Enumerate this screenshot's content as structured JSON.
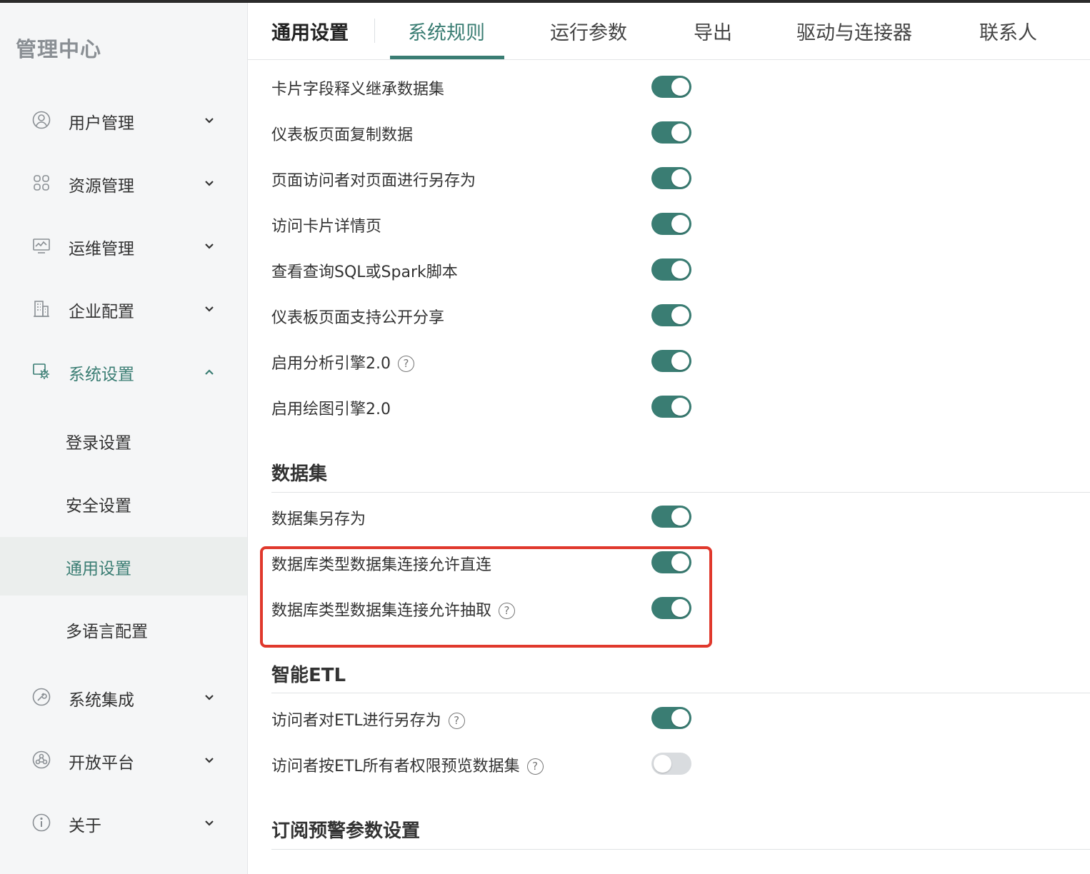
{
  "sidebar": {
    "brand": "管理中心",
    "items": [
      {
        "label": "用户管理",
        "icon": "user-circle-icon"
      },
      {
        "label": "资源管理",
        "icon": "grid-icon"
      },
      {
        "label": "运维管理",
        "icon": "monitor-icon"
      },
      {
        "label": "企业配置",
        "icon": "building-icon"
      },
      {
        "label": "系统设置",
        "icon": "settings-icon"
      },
      {
        "label": "系统集成",
        "icon": "wrench-icon"
      },
      {
        "label": "开放平台",
        "icon": "network-icon"
      },
      {
        "label": "关于",
        "icon": "info-icon"
      }
    ],
    "subitems": [
      {
        "label": "登录设置"
      },
      {
        "label": "安全设置"
      },
      {
        "label": "通用设置"
      },
      {
        "label": "多语言配置"
      }
    ]
  },
  "tabs": [
    {
      "label": "通用设置"
    },
    {
      "label": "系统规则"
    },
    {
      "label": "运行参数"
    },
    {
      "label": "导出"
    },
    {
      "label": "驱动与连接器"
    },
    {
      "label": "联系人"
    }
  ],
  "colors": {
    "accent": "#3a7d73",
    "highlight": "#e0382c",
    "toggle_off": "#d9dcdf"
  },
  "settings_top": [
    {
      "label": "卡片字段释义继承数据集",
      "on": true
    },
    {
      "label": "仪表板页面复制数据",
      "on": true
    },
    {
      "label": "页面访问者对页面进行另存为",
      "on": true
    },
    {
      "label": "访问卡片详情页",
      "on": true
    },
    {
      "label": "查看查询SQL或Spark脚本",
      "on": true
    },
    {
      "label": "仪表板页面支持公开分享",
      "on": true
    },
    {
      "label": "启用分析引擎2.0",
      "on": true,
      "help": true
    },
    {
      "label": "启用绘图引擎2.0",
      "on": true
    }
  ],
  "dataset_section": {
    "title": "数据集",
    "items": [
      {
        "label": "数据集另存为",
        "on": true
      },
      {
        "label": "数据库类型数据集连接允许直连",
        "on": true
      },
      {
        "label": "数据库类型数据集连接允许抽取",
        "on": true,
        "help": true
      }
    ]
  },
  "etl_section": {
    "title": "智能ETL",
    "items": [
      {
        "label": "访问者对ETL进行另存为",
        "on": true,
        "help": true
      },
      {
        "label": "访问者按ETL所有者权限预览数据集",
        "on": false,
        "help": true
      }
    ]
  },
  "alert_section": {
    "title": "订阅预警参数设置"
  }
}
